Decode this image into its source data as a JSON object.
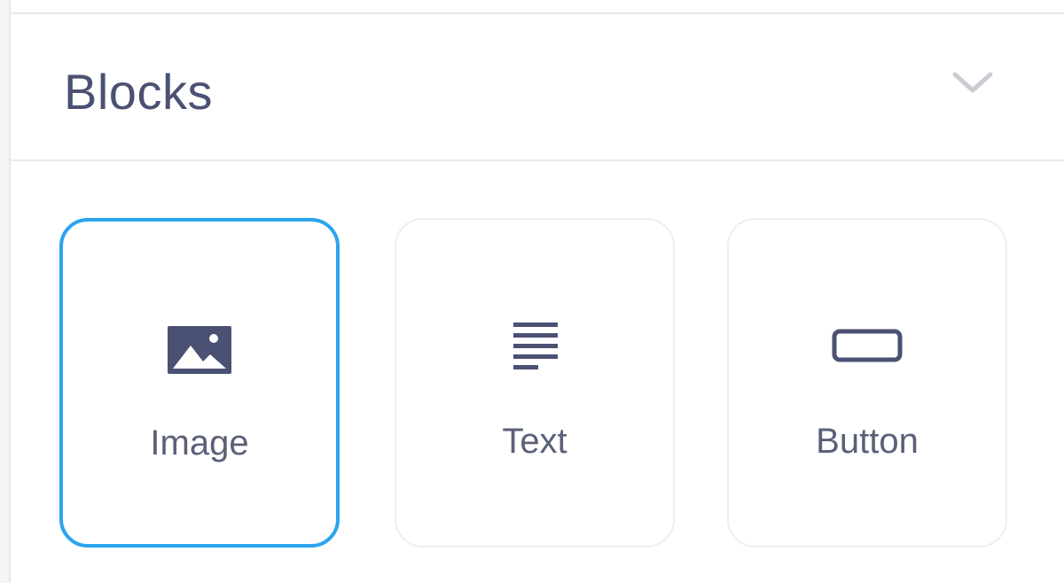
{
  "section": {
    "title": "Blocks",
    "collapse_icon": "chevron-down-icon"
  },
  "blocks": [
    {
      "label": "Image",
      "icon": "image-icon",
      "selected": true
    },
    {
      "label": "Text",
      "icon": "text-lines-icon",
      "selected": false
    },
    {
      "label": "Button",
      "icon": "button-rect-icon",
      "selected": false
    }
  ],
  "colors": {
    "accent": "#2aa4ee",
    "text": "#4b5173",
    "icon": "#4b5173",
    "border": "#eceef1"
  }
}
